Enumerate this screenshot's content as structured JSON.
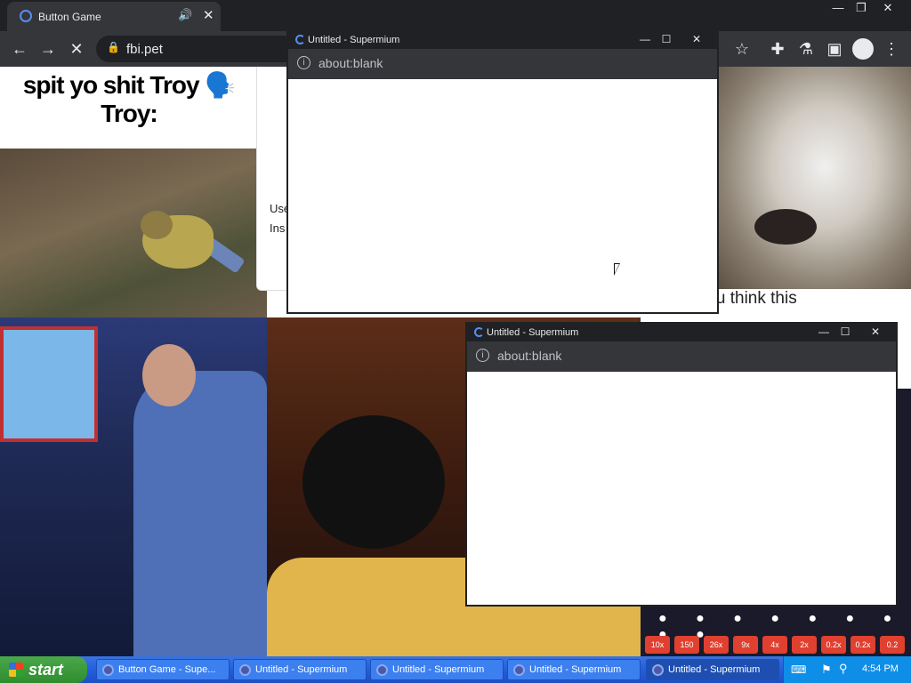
{
  "browser": {
    "tab_title": "Button Game",
    "audio_icon": "🔊",
    "tab_close": "✕",
    "url": "fbi.pet",
    "window_min": "—",
    "window_restore": "❐",
    "window_close": "✕"
  },
  "toolbar": {
    "back": "←",
    "forward": "→",
    "stop": "✕",
    "lock": "🔒",
    "star": "☆",
    "extensions": "✚",
    "lab": "⚗",
    "sidepanel": "▣",
    "menu": "⋮"
  },
  "page": {
    "meme_line1": "spit yo shit Troy 🗣️",
    "meme_line2": "Troy:",
    "dialog_line1": "Use",
    "dialog_line2": "Ins",
    "cat_caption": "made you think this"
  },
  "game": {
    "dots": "● ● ● ● ● ● ● ● ●",
    "chips": [
      "10x",
      "150",
      "26x",
      "9x",
      "4x",
      "2x",
      "0.2x",
      "0.2x",
      "0.2"
    ]
  },
  "popups": [
    {
      "title": "Untitled - Supermium",
      "address": "about:blank"
    },
    {
      "title": "Untitled - Supermium",
      "address": "about:blank"
    }
  ],
  "popup_controls": {
    "min": "—",
    "max": "☐",
    "close": "✕",
    "info": "i"
  },
  "taskbar": {
    "start_label": "start",
    "items": [
      "Button Game - Supe...",
      "Untitled - Supermium",
      "Untitled - Supermium",
      "Untitled - Supermium",
      "Untitled - Supermium"
    ],
    "tray_keyboard": "⌨",
    "tray_network": "⚑",
    "tray_search": "⚲",
    "clock": "4:54 PM"
  }
}
